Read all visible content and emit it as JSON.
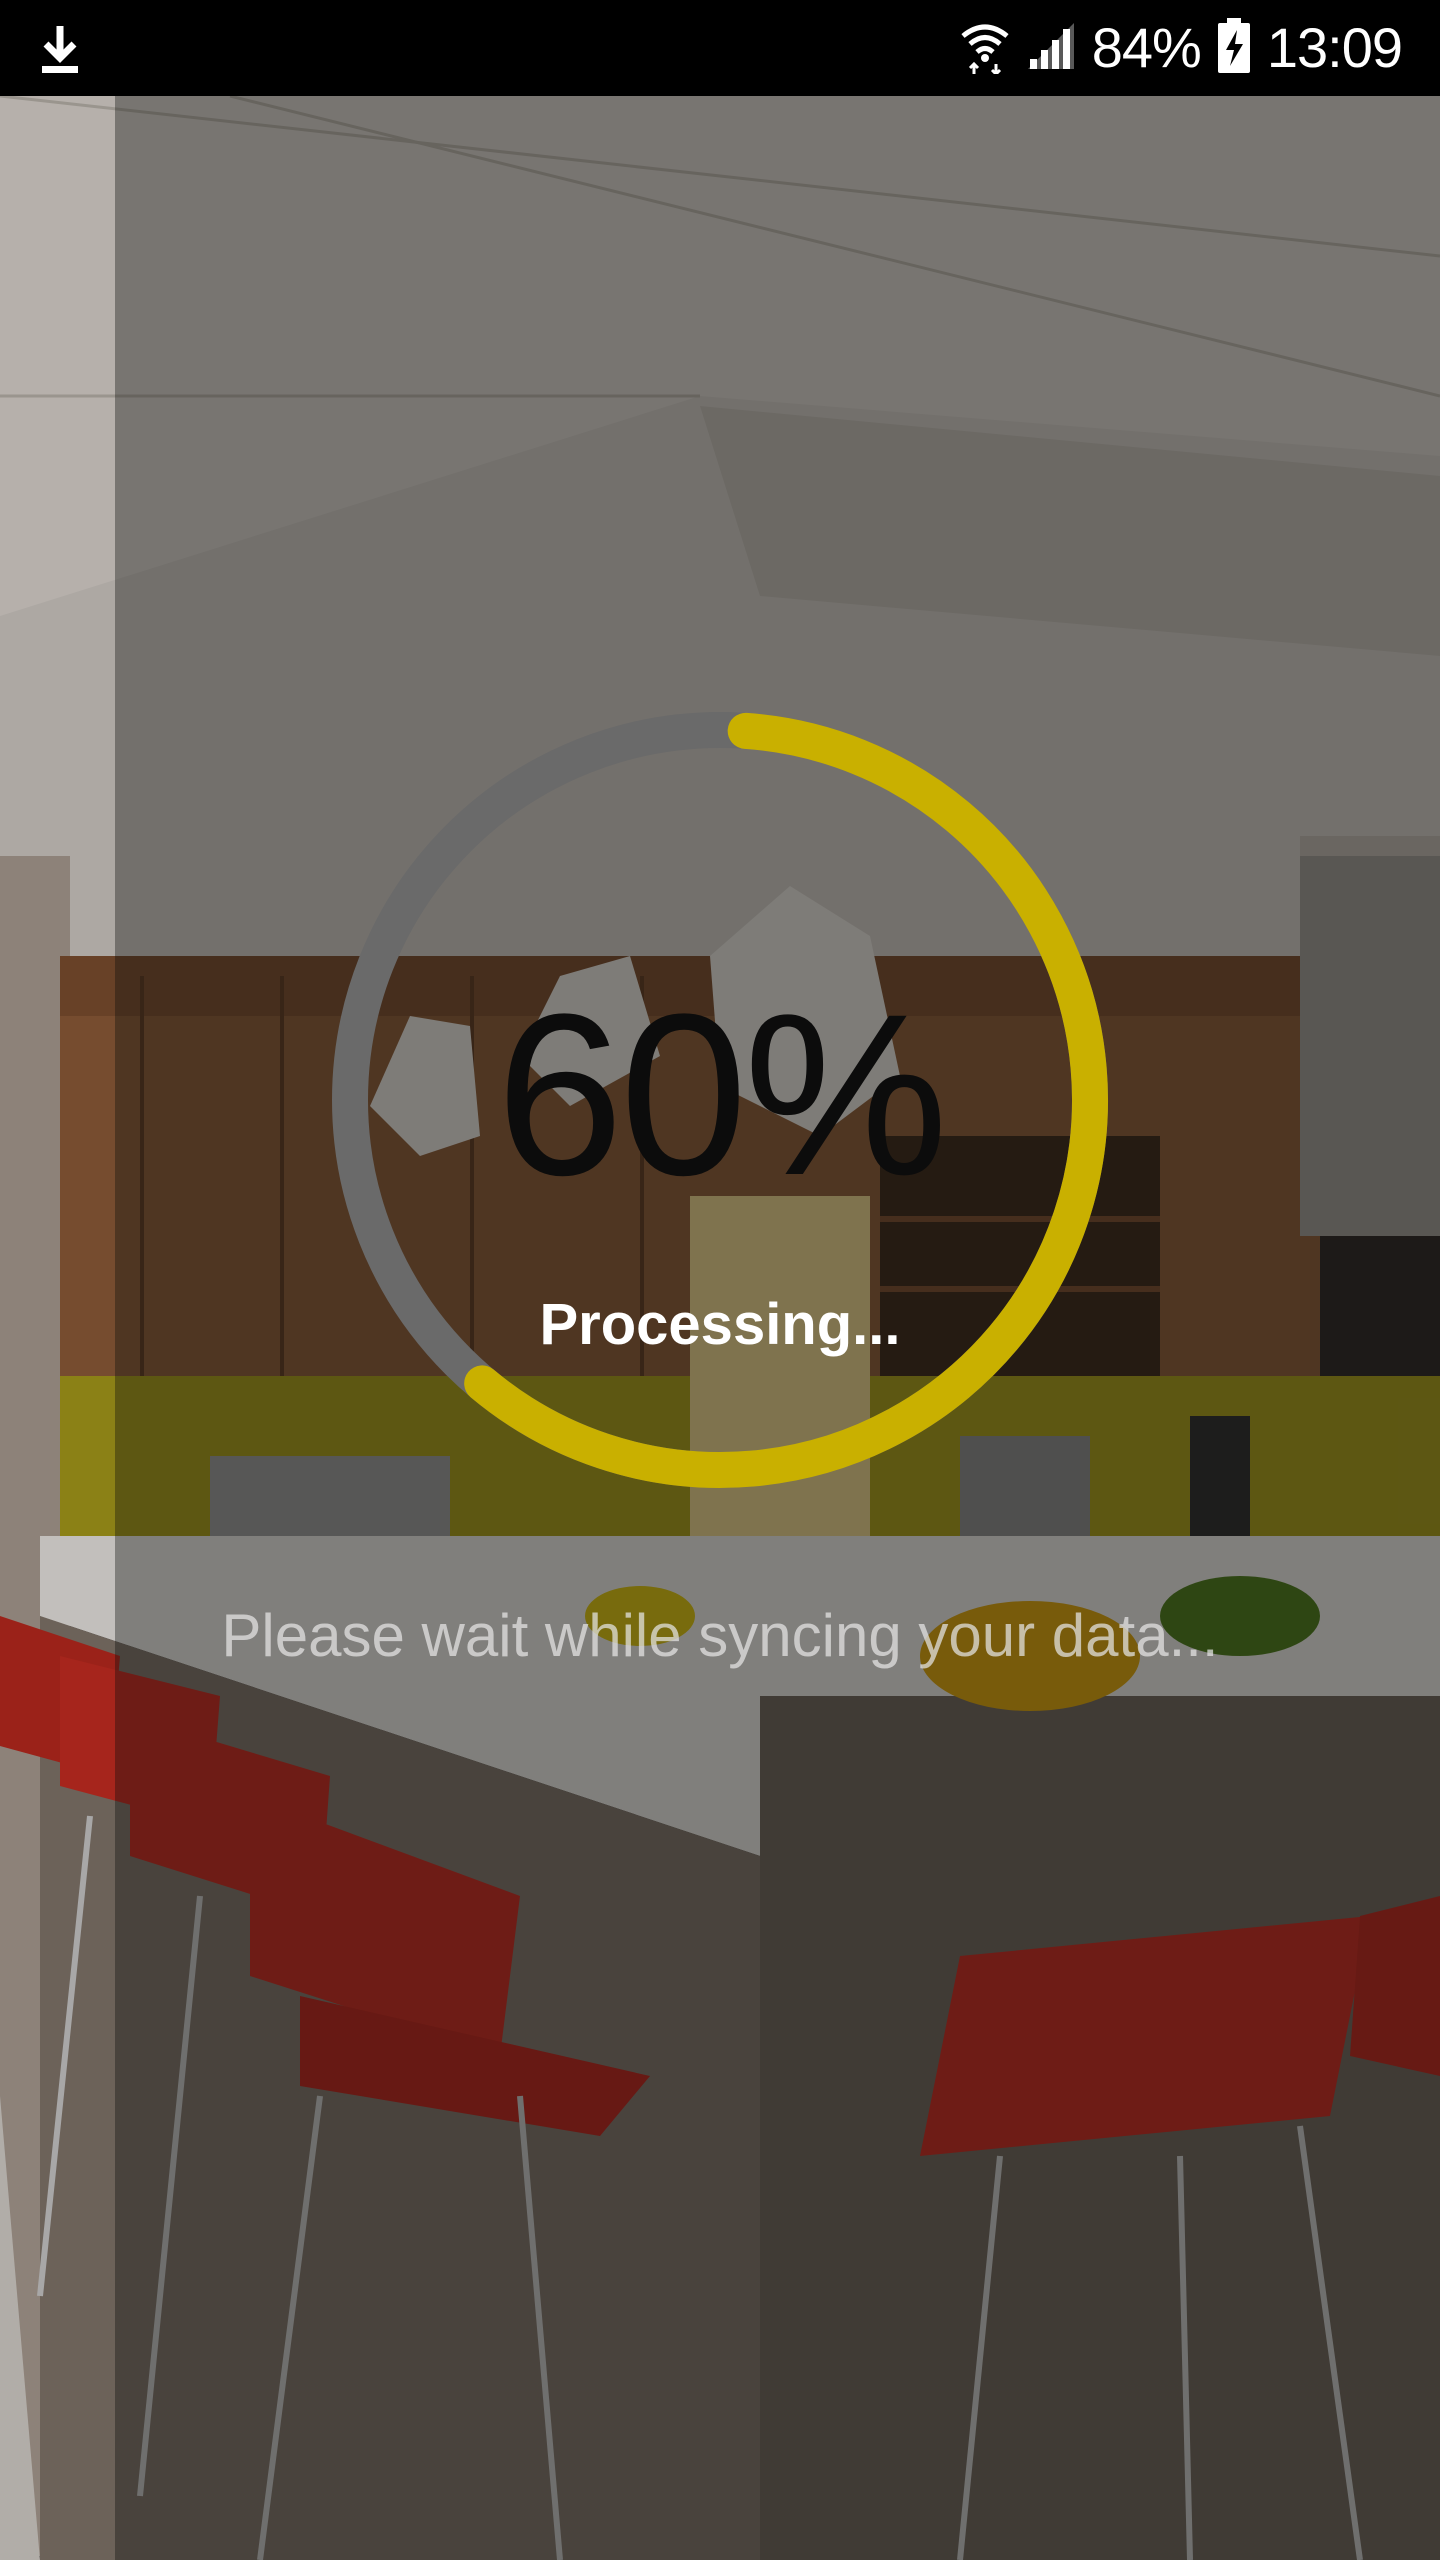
{
  "status_bar": {
    "left_icon": "download-icon",
    "wifi_icon": "wifi-icon",
    "signal_icon": "signal-icon",
    "battery_percent": "84%",
    "battery_icon": "battery-charging-icon",
    "time": "13:09"
  },
  "progress": {
    "percent_text": "60%",
    "value": 60,
    "label": "Processing...",
    "accent_color": "#c9b000",
    "track_color": "#6a6a6a"
  },
  "message": {
    "text": "Please wait while syncing your data..."
  }
}
